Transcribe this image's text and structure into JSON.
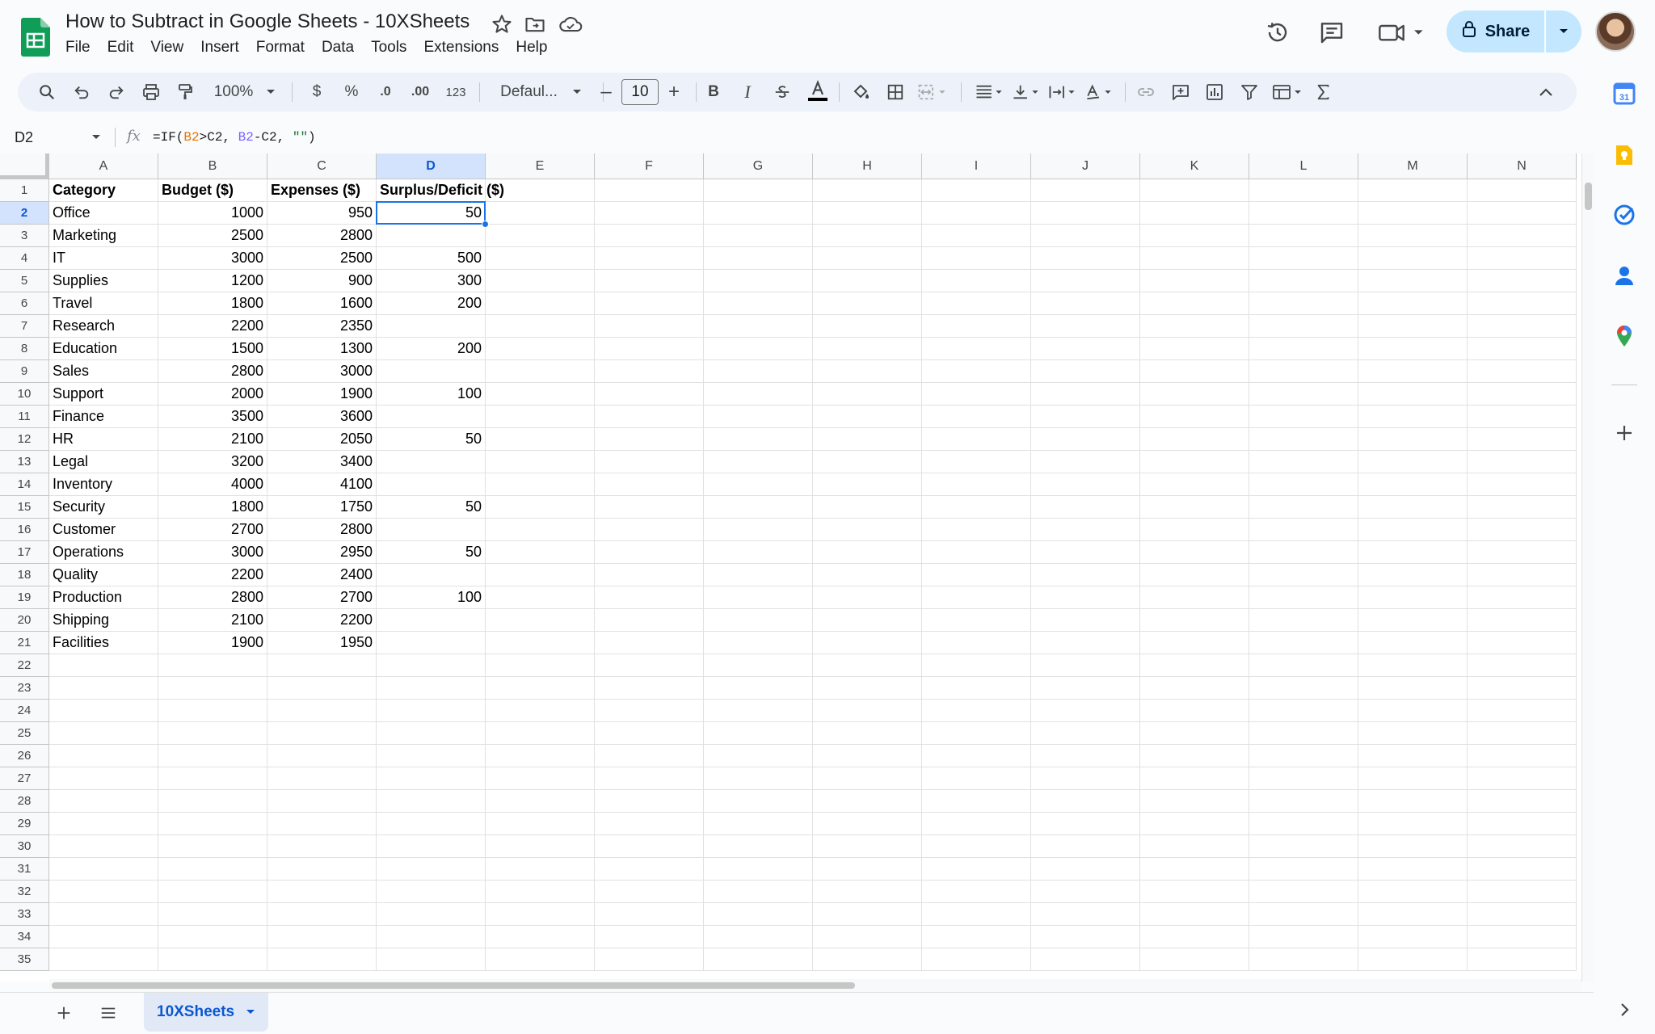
{
  "app": {
    "doc_title": "How to Subtract in Google Sheets - 10XSheets",
    "share_label": "Share",
    "colors": {
      "accent": "#1a73e8",
      "share_bg": "#c2e7ff",
      "logo_green": "#0f9d58"
    }
  },
  "menu": {
    "items": [
      "File",
      "Edit",
      "View",
      "Insert",
      "Format",
      "Data",
      "Tools",
      "Extensions",
      "Help"
    ]
  },
  "toolbar": {
    "zoom": "100%",
    "currency": "$",
    "percent": "%",
    "dec_decrease": ".0",
    "dec_increase": ".00",
    "number_format": "123",
    "font": "Defaul...",
    "font_size": "10",
    "bold": "B",
    "italic": "I",
    "minus": "–",
    "plus": "+"
  },
  "formula_bar": {
    "name_box": "D2",
    "fx": "fx",
    "formula_prefix": "=IF(",
    "ref1": "B2",
    "formula_mid1": ">C2, ",
    "ref2": "B2",
    "formula_mid2": "-C2, ",
    "string_arg": "\"\"",
    "formula_suffix": ")"
  },
  "grid": {
    "selected_cell": "D2",
    "selected_column": "D",
    "selected_row": 2,
    "columns": [
      "A",
      "B",
      "C",
      "D",
      "E",
      "F",
      "G",
      "H",
      "I",
      "J",
      "K",
      "L",
      "M",
      "N"
    ],
    "visible_row_count": 35,
    "rows": [
      [
        "Category",
        "Budget ($)",
        "Expenses ($)",
        "Surplus/Deficit ($)"
      ],
      [
        "Office",
        "1000",
        "950",
        "50"
      ],
      [
        "Marketing",
        "2500",
        "2800",
        ""
      ],
      [
        "IT",
        "3000",
        "2500",
        "500"
      ],
      [
        "Supplies",
        "1200",
        "900",
        "300"
      ],
      [
        "Travel",
        "1800",
        "1600",
        "200"
      ],
      [
        "Research",
        "2200",
        "2350",
        ""
      ],
      [
        "Education",
        "1500",
        "1300",
        "200"
      ],
      [
        "Sales",
        "2800",
        "3000",
        ""
      ],
      [
        "Support",
        "2000",
        "1900",
        "100"
      ],
      [
        "Finance",
        "3500",
        "3600",
        ""
      ],
      [
        "HR",
        "2100",
        "2050",
        "50"
      ],
      [
        "Legal",
        "3200",
        "3400",
        ""
      ],
      [
        "Inventory",
        "4000",
        "4100",
        ""
      ],
      [
        "Security",
        "1800",
        "1750",
        "50"
      ],
      [
        "Customer",
        "2700",
        "2800",
        ""
      ],
      [
        "Operations",
        "3000",
        "2950",
        "50"
      ],
      [
        "Quality",
        "2200",
        "2400",
        ""
      ],
      [
        "Production",
        "2800",
        "2700",
        "100"
      ],
      [
        "Shipping",
        "2100",
        "2200",
        ""
      ],
      [
        "Facilities",
        "1900",
        "1950",
        ""
      ]
    ]
  },
  "sheets": {
    "tabs": [
      {
        "label": "10XSheets",
        "active": true
      }
    ]
  },
  "icons": {
    "title": [
      "star-icon",
      "move-folder-icon",
      "cloud-saved-icon"
    ],
    "top_right": [
      "version-history-icon",
      "comments-icon",
      "meet-icon",
      "lock-icon",
      "avatar"
    ],
    "side_panel": [
      "calendar-icon",
      "keep-icon",
      "tasks-icon",
      "contacts-icon",
      "maps-icon",
      "add-addon-icon"
    ]
  }
}
